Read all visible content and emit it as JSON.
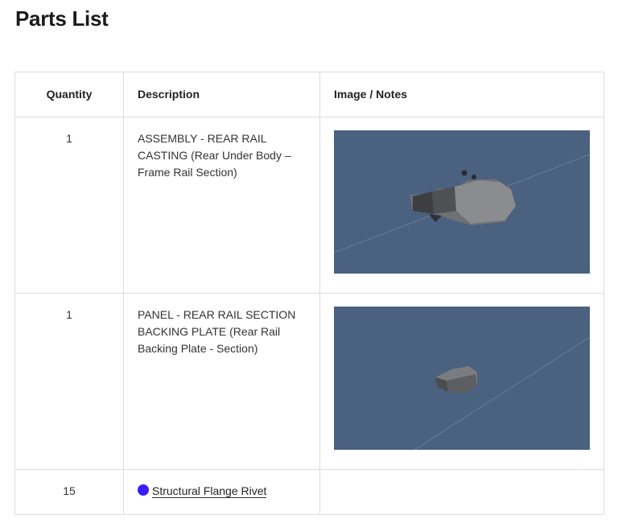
{
  "page": {
    "title": "Parts List"
  },
  "table": {
    "headers": {
      "quantity": "Quantity",
      "description": "Description",
      "notes": "Image / Notes"
    },
    "rows": [
      {
        "quantity": "1",
        "description": "ASSEMBLY - REAR RAIL CASTING (Rear Under Body – Frame Rail Section)",
        "image": "part-render"
      },
      {
        "quantity": "1",
        "description": "PANEL - REAR RAIL SECTION BACKING PLATE (Rear Rail Backing Plate - Section)",
        "image": "part-render"
      },
      {
        "quantity": "15",
        "description": "Structural Flange Rivet",
        "marker_color": "#3a1dff"
      }
    ]
  },
  "colors": {
    "render_background": "#4a6180",
    "border": "#dcdcdc"
  }
}
